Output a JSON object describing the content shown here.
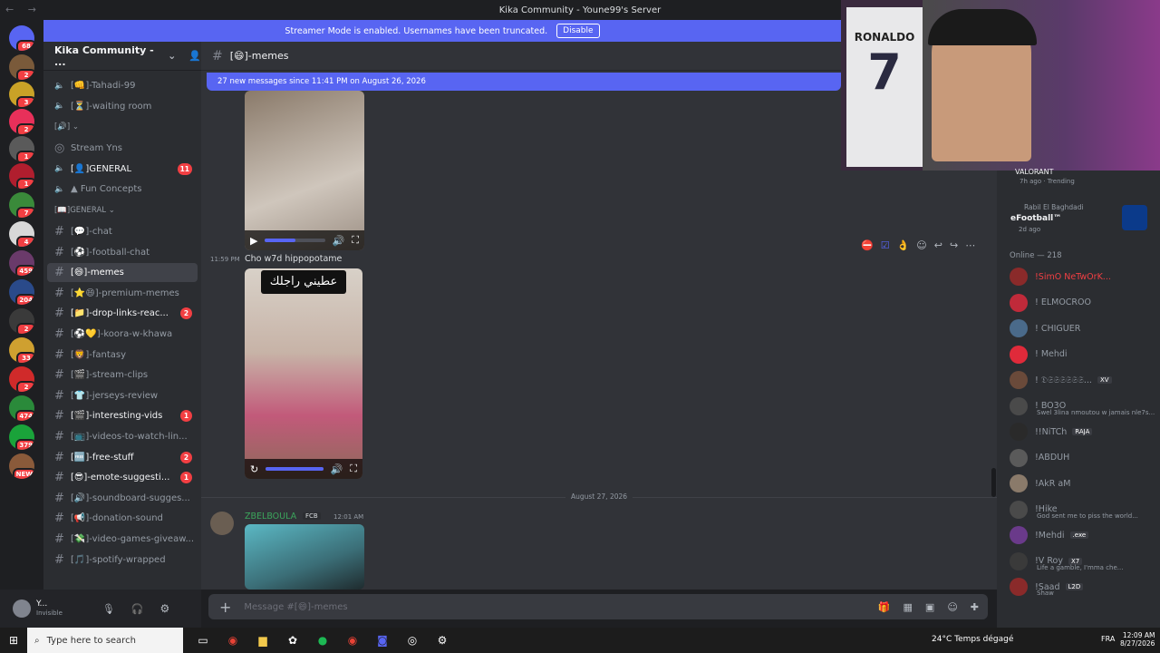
{
  "window": {
    "title": "Kika Community - Youne99's Server"
  },
  "banner": {
    "text": "Streamer Mode is enabled. Usernames have been truncated.",
    "button": "Disable"
  },
  "server": {
    "name": "Kika Community - ..."
  },
  "server_badges": [
    "68",
    "2",
    "3",
    "2",
    "1",
    "1",
    "7",
    "4",
    "459",
    "204",
    "2",
    "33",
    "2",
    "474",
    "379",
    "NEW"
  ],
  "channels": [
    {
      "label": "[👊]-Tahadi-99",
      "type": "voice"
    },
    {
      "label": "[⏳]-waiting room",
      "type": "voice"
    },
    {
      "label": "[🔊] ⌄",
      "type": "category"
    },
    {
      "label": "Stream Yns",
      "type": "stage"
    },
    {
      "label": "[👤]GENERAL",
      "type": "voice",
      "badge": "11"
    },
    {
      "label": "▲ Fun Concepts",
      "type": "voice"
    },
    {
      "label": "[📖]GENERAL ⌄",
      "type": "category"
    },
    {
      "label": "[💬]-chat",
      "type": "text"
    },
    {
      "label": "[⚽]-football-chat",
      "type": "text"
    },
    {
      "label": "[😄]-memes",
      "type": "text",
      "active": true
    },
    {
      "label": "[⭐😄]-premium-memes",
      "type": "text"
    },
    {
      "label": "[📁]-drop-links-reac...",
      "type": "text",
      "badge": "2"
    },
    {
      "label": "[⚽💛]-koora-w-khawa",
      "type": "text"
    },
    {
      "label": "[🦁]-fantasy",
      "type": "text"
    },
    {
      "label": "[🎬]-stream-clips",
      "type": "text"
    },
    {
      "label": "[👕]-jerseys-review",
      "type": "text"
    },
    {
      "label": "[🎬]-interesting-vids",
      "type": "text",
      "badge": "1"
    },
    {
      "label": "[📺]-videos-to-watch-lin...",
      "type": "text"
    },
    {
      "label": "[🆓]-free-stuff",
      "type": "text",
      "badge": "2"
    },
    {
      "label": "[😎]-emote-suggesti...",
      "type": "text",
      "badge": "1"
    },
    {
      "label": "[🔊]-soundboard-sugges...",
      "type": "text"
    },
    {
      "label": "[📢]-donation-sound",
      "type": "text"
    },
    {
      "label": "[💸]-video-games-giveaw...",
      "type": "text"
    },
    {
      "label": "[🎵]-spotify-wrapped",
      "type": "text"
    }
  ],
  "user": {
    "name": "Y...",
    "status": "Invisible"
  },
  "channel_header": {
    "name": "[😄]-memes"
  },
  "newbar": {
    "text": "27 new messages since 11:41 PM on August 26, 2026"
  },
  "messages": [
    {
      "time": "11:59 PM",
      "text": "Cho w7d hippopotame",
      "overlay": "عطيني راجلك"
    },
    {
      "author": "ZBELBOULA",
      "tag": "FCB",
      "time": "12:01 AM"
    }
  ],
  "divider": {
    "date": "August 27, 2026"
  },
  "composer": {
    "placeholder": "Message #[😄]-memes"
  },
  "members": {
    "activity": [
      {
        "title": "VALORANT",
        "meta": "7h ago · Trending"
      },
      {
        "user": "Rabil El Baghdadi",
        "title": "eFootball™",
        "meta": "2d ago"
      }
    ],
    "online_header": "Online — 218",
    "list": [
      {
        "name": "!SimO NeTwOrK..."
      },
      {
        "name": "! ELMOCROO"
      },
      {
        "name": "! CHIGUER"
      },
      {
        "name": "! Mehdi"
      },
      {
        "name": "! 𝔇𝔖𝔖𝔖𝔖𝔖𝔖...",
        "tag": "XV"
      },
      {
        "name": "! BO3O",
        "sub": "Swel 3lina nmoutou w jamais nle7s..."
      },
      {
        "name": "!!NiTCh",
        "tag": "RAJA"
      },
      {
        "name": "!ABDUH"
      },
      {
        "name": "!AkR aM"
      },
      {
        "name": "!Hike",
        "sub": "God sent me to piss the world..."
      },
      {
        "name": "!Mehdi",
        "tag": ".exe"
      },
      {
        "name": "!V Roy",
        "tag": "X7",
        "sub": "Life a gamble, I'mma che..."
      },
      {
        "name": "!Saad",
        "tag": "L2D",
        "sub": "Shaw"
      }
    ]
  },
  "webcam": {
    "jersey_name": "RONALDO",
    "jersey_number": "7"
  },
  "taskbar": {
    "search": "Type here to search",
    "weather": "24°C Temps dégagé",
    "lang": "FRA",
    "time": "12:09 AM",
    "date": "8/27/2026"
  }
}
